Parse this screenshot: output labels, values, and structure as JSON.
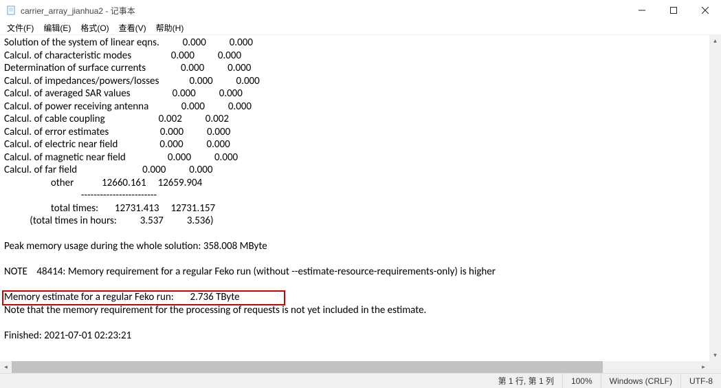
{
  "window": {
    "title": "carrier_array_jianhua2 - 记事本"
  },
  "menu": {
    "file": "文件(F)",
    "edit": "编辑(E)",
    "format": "格式(O)",
    "view": "查看(V)",
    "help": "帮助(H)"
  },
  "content": {
    "text": "Solution of the system of linear eqns.          0.000          0.000\nCalcul. of characteristic modes                 0.000          0.000\nDetermination of surface currents               0.000          0.000\nCalcul. of impedances/powers/losses             0.000          0.000\nCalcul. of averaged SAR values                  0.000          0.000\nCalcul. of power receiving antenna              0.000          0.000\nCalcul. of cable coupling                       0.002          0.002\nCalcul. of error estimates                      0.000          0.000\nCalcul. of electric near field                  0.000          0.000\nCalcul. of magnetic near field                  0.000          0.000\nCalcul. of far field                            0.000          0.000\n                    other            12660.161     12659.904\n                                 ------------------------\n                    total times:       12731.413     12731.157\n           (total times in hours:          3.537          3.536)\n\nPeak memory usage during the whole solution: 358.008 MByte\n\nNOTE    48414: Memory requirement for a regular Feko run (without --estimate-resource-requirements-only) is higher\n\nMemory estimate for a regular Feko run:       2.736 TByte\nNote that the memory requirement for the processing of requests is not yet included in the estimate.\n\nFinished: 2021-07-01 02:23:21"
  },
  "status": {
    "position": "第 1 行, 第 1 列",
    "zoom": "100%",
    "eol": "Windows (CRLF)",
    "encoding": "UTF-8"
  }
}
